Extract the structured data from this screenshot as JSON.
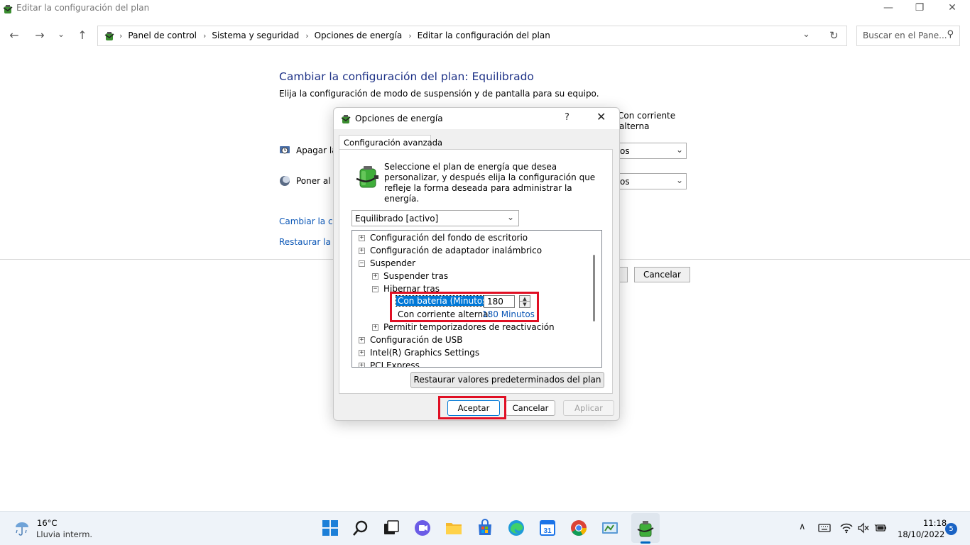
{
  "window": {
    "title": "Editar la configuración del plan",
    "minimize_glyph": "—",
    "maximize_glyph": "❐",
    "close_glyph": "✕"
  },
  "nav": {
    "back_glyph": "←",
    "forward_glyph": "→",
    "recent_glyph": "⌄",
    "up_glyph": "↑",
    "breadcrumb": [
      "Panel de control",
      "Sistema y seguridad",
      "Opciones de energía",
      "Editar la configuración del plan"
    ],
    "sep_glyph": "›",
    "dropdown_glyph": "⌄",
    "refresh_glyph": "↻",
    "search_placeholder": "Buscar en el Pane...",
    "search_glyph": "⚲"
  },
  "background": {
    "heading": "Cambiar la configuración del plan: Equilibrado",
    "subtitle": "Elija la configuración de modo de suspensión y de pantalla para su equipo.",
    "column_header_line1": "Con corriente",
    "column_header_line2": "alterna",
    "row1_label": "Apagar la",
    "row1_value": "os",
    "row2_label": "Poner al e",
    "row2_value": "os",
    "select_chevron": "⌄",
    "link_change": "Cambiar la cor",
    "link_restore": "Restaurar la co",
    "cancel": "Cancelar"
  },
  "dialog": {
    "title": "Opciones de energía",
    "help_glyph": "?",
    "close_glyph": "✕",
    "tab": "Configuración avanzada",
    "intro": "Seleccione el plan de energía que desea personalizar, y después elija la configuración que refleje la forma deseada para administrar la energía.",
    "plan_select": "Equilibrado [activo]",
    "select_chevron": "⌄",
    "expand_plus": "+",
    "expand_minus": "−",
    "tree": {
      "item1": "Configuración del fondo de escritorio",
      "item2": "Configuración de adaptador inalámbrico",
      "item3": "Suspender",
      "item3_1": "Suspender tras",
      "item3_2": "Hibernar tras",
      "battery_label": "Con batería (Minutos):",
      "battery_value": "180",
      "ac_label": "Con corriente alterna:",
      "ac_value": "180 Minutos",
      "item3_3": "Permitir temporizadores de reactivación",
      "item4": "Configuración de USB",
      "item5": "Intel(R) Graphics Settings",
      "item6": "PCI Express"
    },
    "spin_up": "▲",
    "spin_down": "▼",
    "restore_button": "Restaurar valores predeterminados del plan",
    "accept": "Aceptar",
    "cancel": "Cancelar",
    "apply": "Aplicar"
  },
  "taskbar": {
    "temperature": "16°C",
    "weather": "Lluvia interm.",
    "tray_up_glyph": "∧",
    "time": "11:18",
    "date": "18/10/2022",
    "notifications": "5"
  },
  "colors": {
    "heading_blue": "#1e3287",
    "link_blue": "#0a56b6",
    "selection_blue": "#0078d7",
    "highlight_red": "#e00f24",
    "taskbar_bg": "#eef3f9"
  }
}
